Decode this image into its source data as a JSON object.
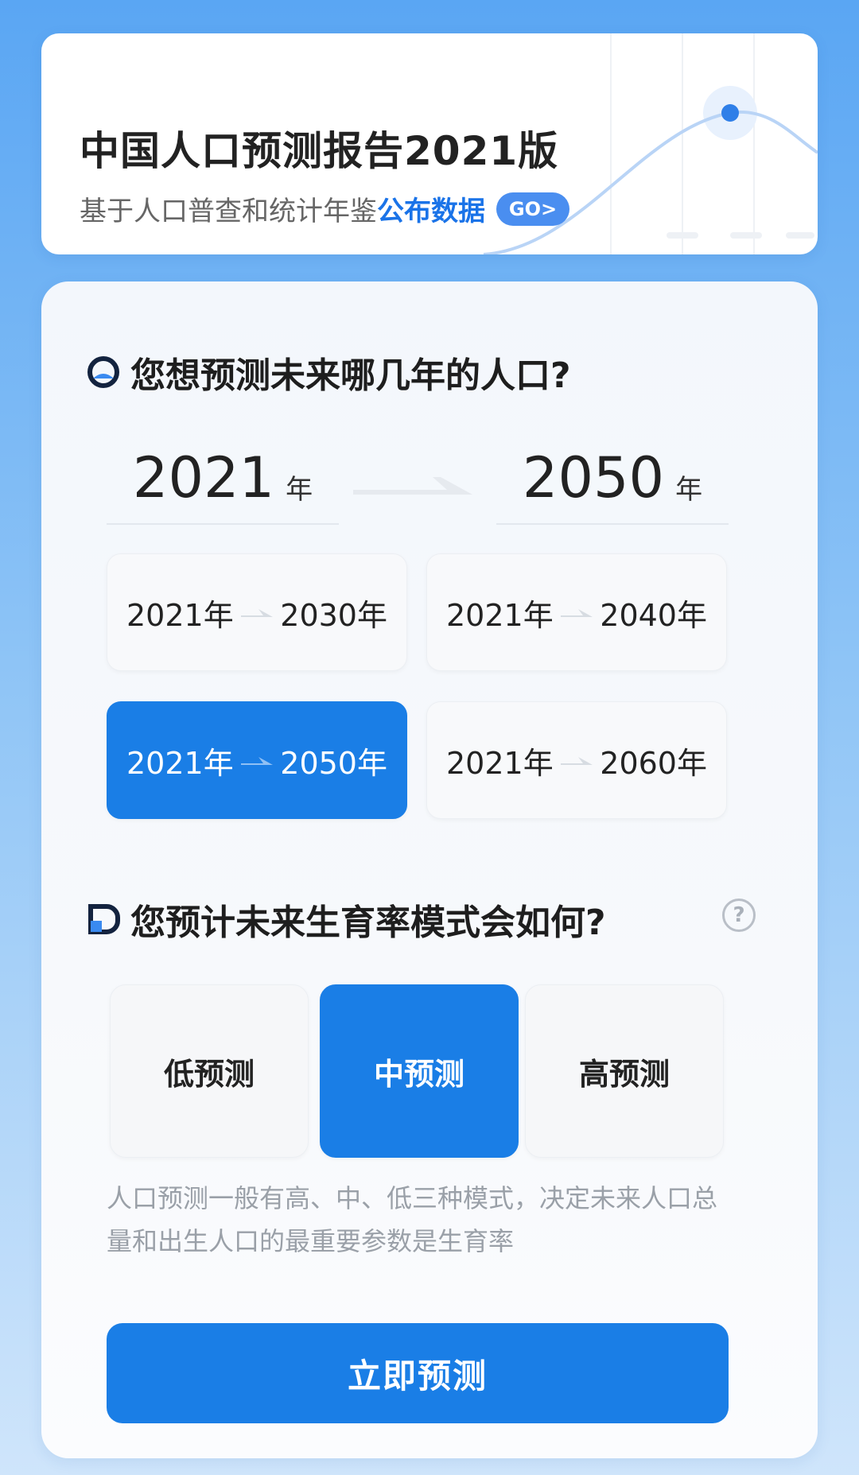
{
  "header": {
    "title": "中国人口预测报告2021版",
    "subtitle_prefix": "基于人口普查和统计年鉴",
    "subtitle_highlight": "公布数据",
    "go_label": "GO>"
  },
  "years_section": {
    "title": "您想预测未来哪几年的人口?",
    "start_year": "2021",
    "end_year": "2050",
    "year_unit": "年",
    "ranges": [
      {
        "from": "2021年",
        "to": "2030年",
        "selected": false
      },
      {
        "from": "2021年",
        "to": "2040年",
        "selected": false
      },
      {
        "from": "2021年",
        "to": "2050年",
        "selected": true
      },
      {
        "from": "2021年",
        "to": "2060年",
        "selected": false
      }
    ]
  },
  "fertility_section": {
    "title": "您预计未来生育率模式会如何?",
    "help_symbol": "?",
    "options": [
      {
        "label": "低预测",
        "selected": false
      },
      {
        "label": "中预测",
        "selected": true
      },
      {
        "label": "高预测",
        "selected": false
      }
    ],
    "description": "人口预测一般有高、中、低三种模式，决定未来人口总量和出生人口的最重要参数是生育率"
  },
  "action": {
    "predict_label": "立即预测"
  },
  "colors": {
    "accent": "#1a7ee6",
    "link": "#1a73e8",
    "go_button": "#4a8ef0"
  }
}
